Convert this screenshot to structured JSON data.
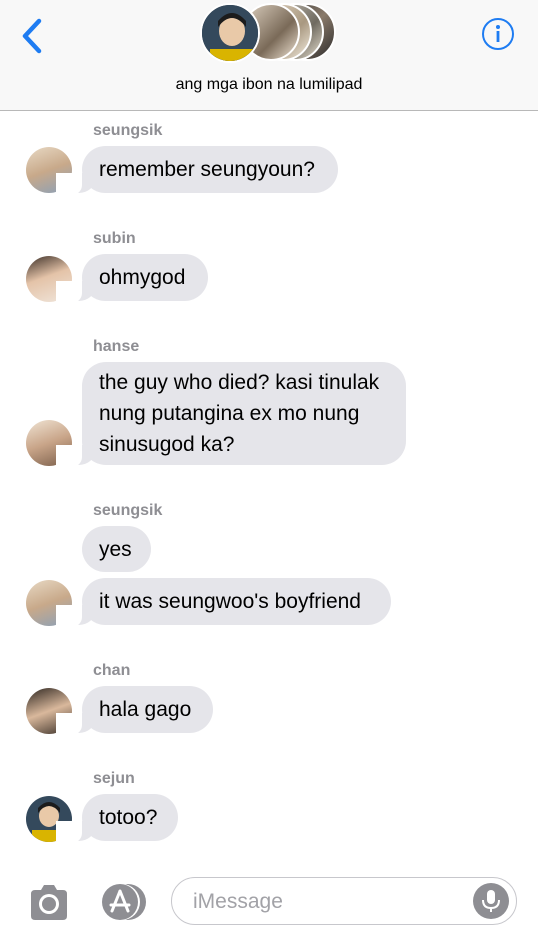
{
  "header": {
    "group_name": "ang mga ibon na lumilipad",
    "accent_color": "#1e7cf2"
  },
  "messages": [
    {
      "sender": "seungsik",
      "text": "remember seungyoun?"
    },
    {
      "sender": "subin",
      "text": "ohmygod"
    },
    {
      "sender": "hanse",
      "lines": [
        "the guy who died? kasi tinulak",
        "nung putangina ex mo nung",
        "sinusugod ka?"
      ]
    },
    {
      "sender": "seungsik",
      "texts": [
        "yes",
        "it was seungwoo's boyfriend"
      ]
    },
    {
      "sender": "chan",
      "text": "hala gago"
    },
    {
      "sender": "sejun",
      "text": "totoo?"
    }
  ],
  "composer": {
    "placeholder": "iMessage",
    "icons": [
      "camera-icon",
      "app-store-icon",
      "microphone-icon"
    ]
  }
}
